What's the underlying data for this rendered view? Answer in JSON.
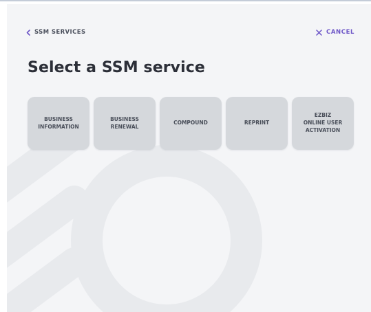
{
  "nav": {
    "back_label": "SSM SERVICES",
    "cancel_label": "CANCEL"
  },
  "page": {
    "title": "Select a SSM service"
  },
  "services": [
    {
      "label": "BUSINESS\nINFORMATION"
    },
    {
      "label": "BUSINESS\nRENEWAL"
    },
    {
      "label": "COMPOUND"
    },
    {
      "label": "REPRINT"
    },
    {
      "label": "EZBIZ\nONLINE USER\nACTIVATION"
    }
  ],
  "colors": {
    "accent": "#6c55c7",
    "background": "#f4f5f7",
    "tile": "#d5d8dc",
    "title_text": "#2c2f38"
  },
  "icons": {
    "back": "chevron-left-icon",
    "cancel": "close-icon"
  }
}
